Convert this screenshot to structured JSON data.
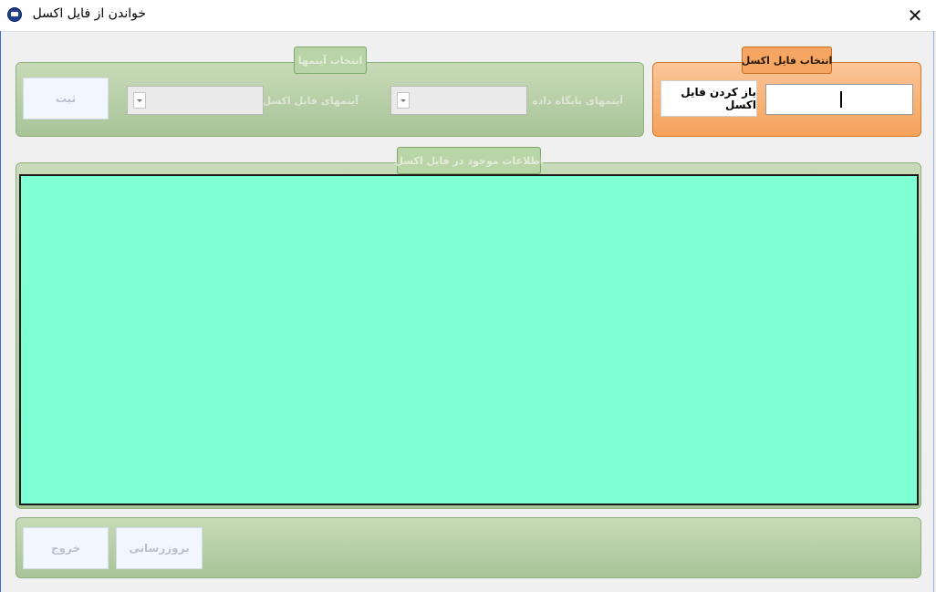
{
  "window": {
    "title": "خواندن از فایل اکسل",
    "close_glyph": "✕"
  },
  "excel_group": {
    "legend": "انتخاب فایل اکسل",
    "open_button": "باز کردن فایل اکسل",
    "path_value": ""
  },
  "columns_group": {
    "legend": "انتخاب آیتمها",
    "db_items_label": "آیتمهای پایگاه داده",
    "excel_items_label": "آیتمهای فایل اکسل",
    "submit_button": "ثبت"
  },
  "data_group": {
    "legend": "اطلاعات موجود در فایل اکسل",
    "grid_color": "#7fffd4"
  },
  "bottom_bar": {
    "update_button": "بروزرسانی",
    "exit_button": "خروج"
  },
  "colors": {
    "green_group": "#b3cda3",
    "orange_group": "#f8b279"
  }
}
